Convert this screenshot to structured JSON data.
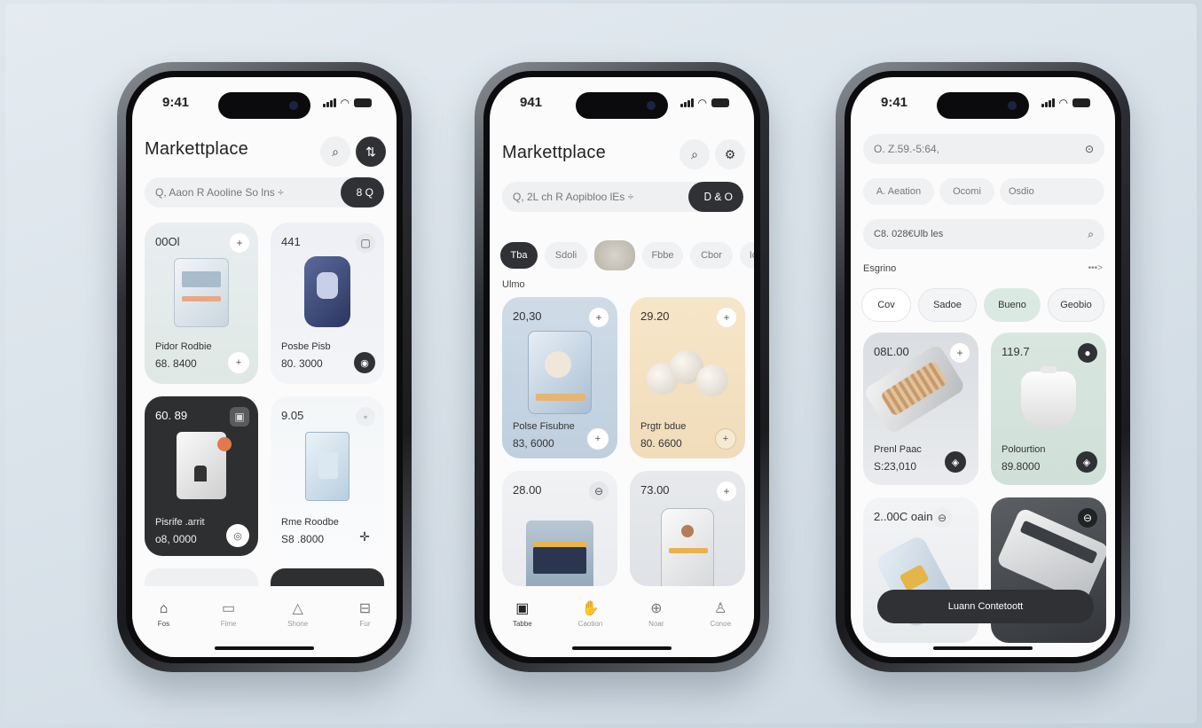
{
  "phones": [
    {
      "time": "9:41",
      "title": "Markettplace",
      "search": {
        "text": "Q, Aaon  R Aooline  So  lns  ÷",
        "dark": "8 Q"
      },
      "cards": [
        {
          "price": "00Ol",
          "name": "Pidor Rodbie",
          "amount": "68. 8400"
        },
        {
          "price": "441",
          "name": "Posbe Pisb",
          "amount": "80. 3000"
        },
        {
          "price": "60. 89",
          "name": "Pisrife .arrit",
          "amount": "o8, 0000"
        },
        {
          "price": "9.05",
          "name": "Rme Roodbe",
          "amount": "S8 .8000"
        }
      ],
      "tabs": [
        "Fos",
        "Fime",
        "Shone",
        "Fur"
      ]
    },
    {
      "time": "941",
      "title": "Markettplace",
      "search": {
        "text": "Q, 2L ch  R  Aopibloo  lEs  ÷",
        "dark": "Ꭰ  & O"
      },
      "chips": [
        "Tba",
        "Sdoli",
        "Fbbe",
        "Cbor",
        "Ic"
      ],
      "section": "Ulmo",
      "cards": [
        {
          "price": "20,30",
          "name": "Polse Fisubne",
          "amount": "83, 6000"
        },
        {
          "price": "29.20",
          "name": "Prgtr bdue",
          "amount": "80. 6600"
        },
        {
          "price": "28.00"
        },
        {
          "price": "73.00"
        }
      ],
      "tabs": [
        "Tabbe",
        "Caotion",
        "Noar",
        "Conoe"
      ]
    },
    {
      "time": "9:41",
      "search_top": "O. Z.59.-5:64,",
      "filters": [
        "A. Aeation",
        "Ocomi",
        "Osdio"
      ],
      "search2": "C8. 028€Ulb les",
      "section": "Esgrino",
      "section_more": "•••>",
      "chips": [
        "Cov",
        "Sadoe",
        "Bueno",
        "Geobio"
      ],
      "cards": [
        {
          "price": "08Ľ.00",
          "name": "Prenl Paac",
          "amount": "S:23,010"
        },
        {
          "price": "119.7",
          "name": "Polourtion",
          "amount": "89.8000"
        },
        {
          "price": "2..00C oain"
        },
        {
          "price": ""
        }
      ],
      "cta": "Luann Contetoott"
    }
  ]
}
